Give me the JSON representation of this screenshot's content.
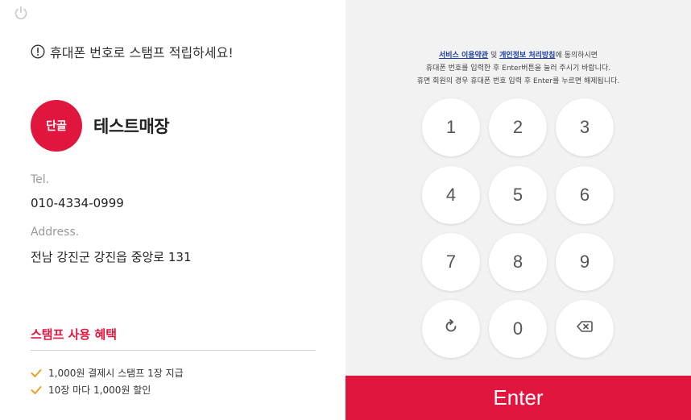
{
  "notice": {
    "text": "휴대폰 번호로 스탬프 적립하세요!"
  },
  "store": {
    "badge": "단골",
    "name": "테스트매장",
    "tel_label": "Tel.",
    "tel": "010-4334-0999",
    "address_label": "Address.",
    "address": "전남 강진군 강진읍 중앙로 131"
  },
  "benefits": {
    "title": "스탬프 사용 혜택",
    "items": [
      {
        "text": "1,000원 결제시 스탬프 1장 지급"
      },
      {
        "text": "10장 마다 1,000원 할인"
      }
    ]
  },
  "terms": {
    "link1": "서비스 이용약관",
    "and": "및",
    "link2": "개인정보 처리방침",
    "line1_rest": "에 동의하시면",
    "line2": "휴대폰 번호를 입력한 후 Enter버튼을 눌러 주시기 바랍니다.",
    "line3": "휴면 회원의 경우 휴대폰 번호 입력 후 Enter를 누르면 해제됩니다."
  },
  "keypad": {
    "k1": "1",
    "k2": "2",
    "k3": "3",
    "k4": "4",
    "k5": "5",
    "k6": "6",
    "k7": "7",
    "k8": "8",
    "k9": "9",
    "k0": "0",
    "reset_icon": "refresh-icon",
    "backspace_icon": "backspace-icon"
  },
  "enter_label": "Enter",
  "colors": {
    "accent": "#e0163f",
    "link": "#1b3fa3",
    "panel": "#f2f2f2"
  }
}
